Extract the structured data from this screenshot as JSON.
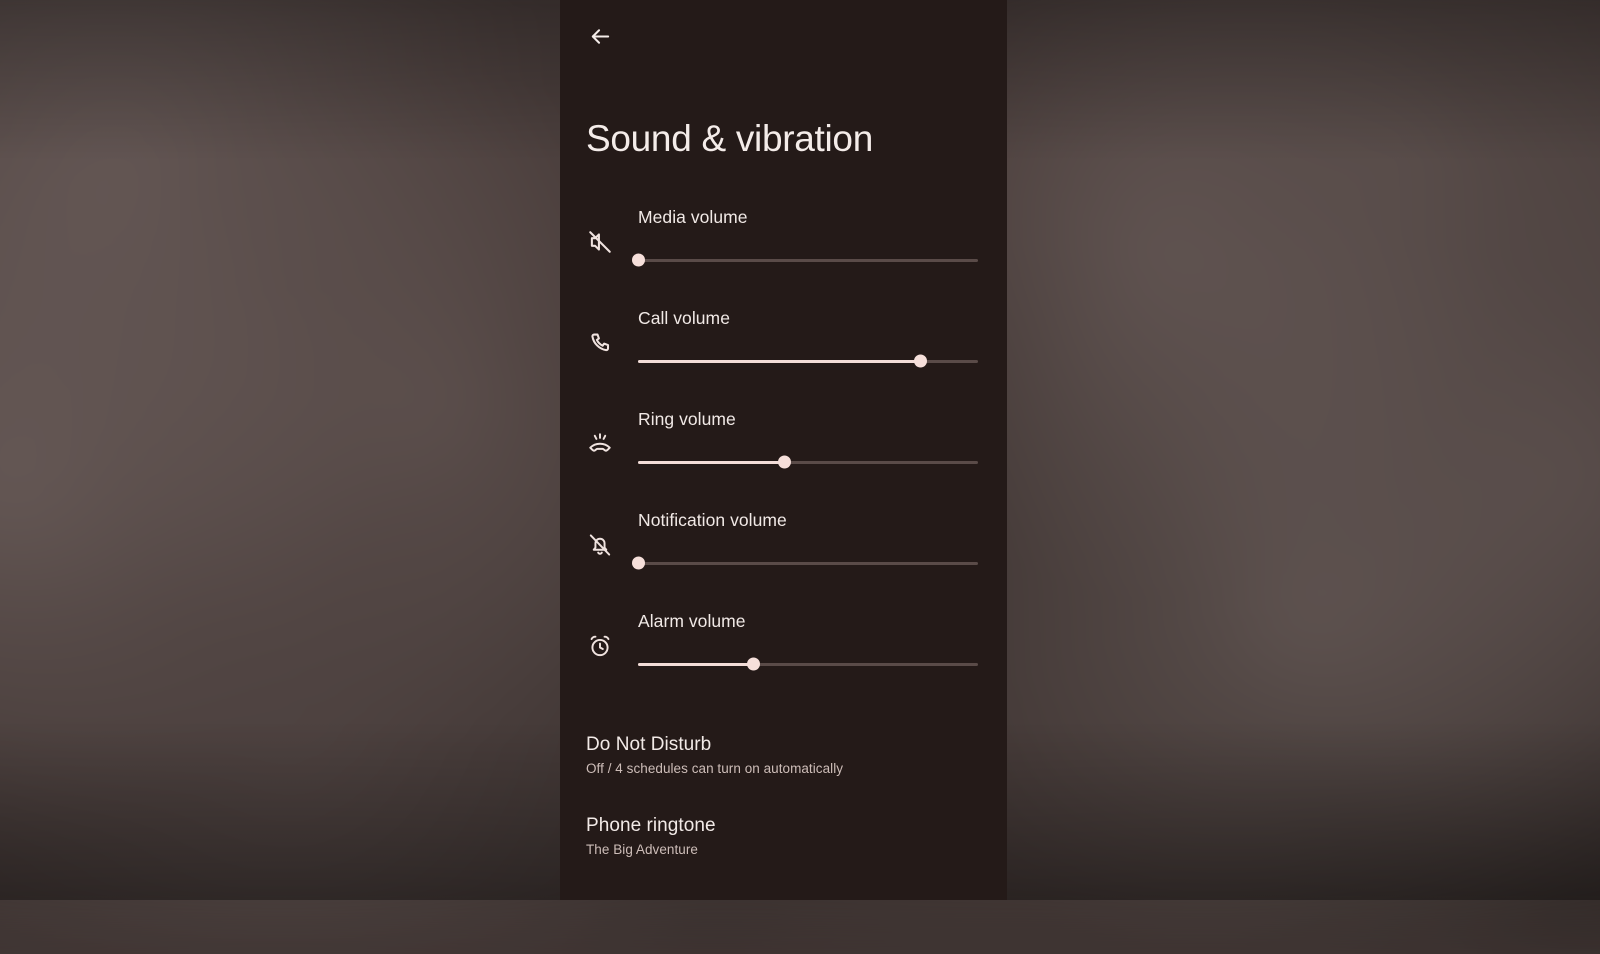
{
  "window": {
    "background_color": "#3f3432",
    "panel_color": "#241a18",
    "accent_color": "#f6dfda",
    "text_color": "#f2eae7",
    "secondary_text_color": "#cdbdb8"
  },
  "header": {
    "back_icon": "arrow-left-icon",
    "title": "Sound & vibration"
  },
  "volumes": [
    {
      "icon": "volume-off-icon",
      "label": "Media volume",
      "value": 0,
      "max": 100
    },
    {
      "icon": "phone-call-icon",
      "label": "Call volume",
      "value": 83,
      "max": 100
    },
    {
      "icon": "ring-volume-icon",
      "label": "Ring volume",
      "value": 43,
      "max": 100
    },
    {
      "icon": "notifications-off-icon",
      "label": "Notification volume",
      "value": 0,
      "max": 100
    },
    {
      "icon": "alarm-clock-icon",
      "label": "Alarm volume",
      "value": 34,
      "max": 100
    }
  ],
  "settings": [
    {
      "title": "Do Not Disturb",
      "subtitle": "Off / 4 schedules can turn on automatically"
    },
    {
      "title": "Phone ringtone",
      "subtitle": "The Big Adventure"
    }
  ]
}
